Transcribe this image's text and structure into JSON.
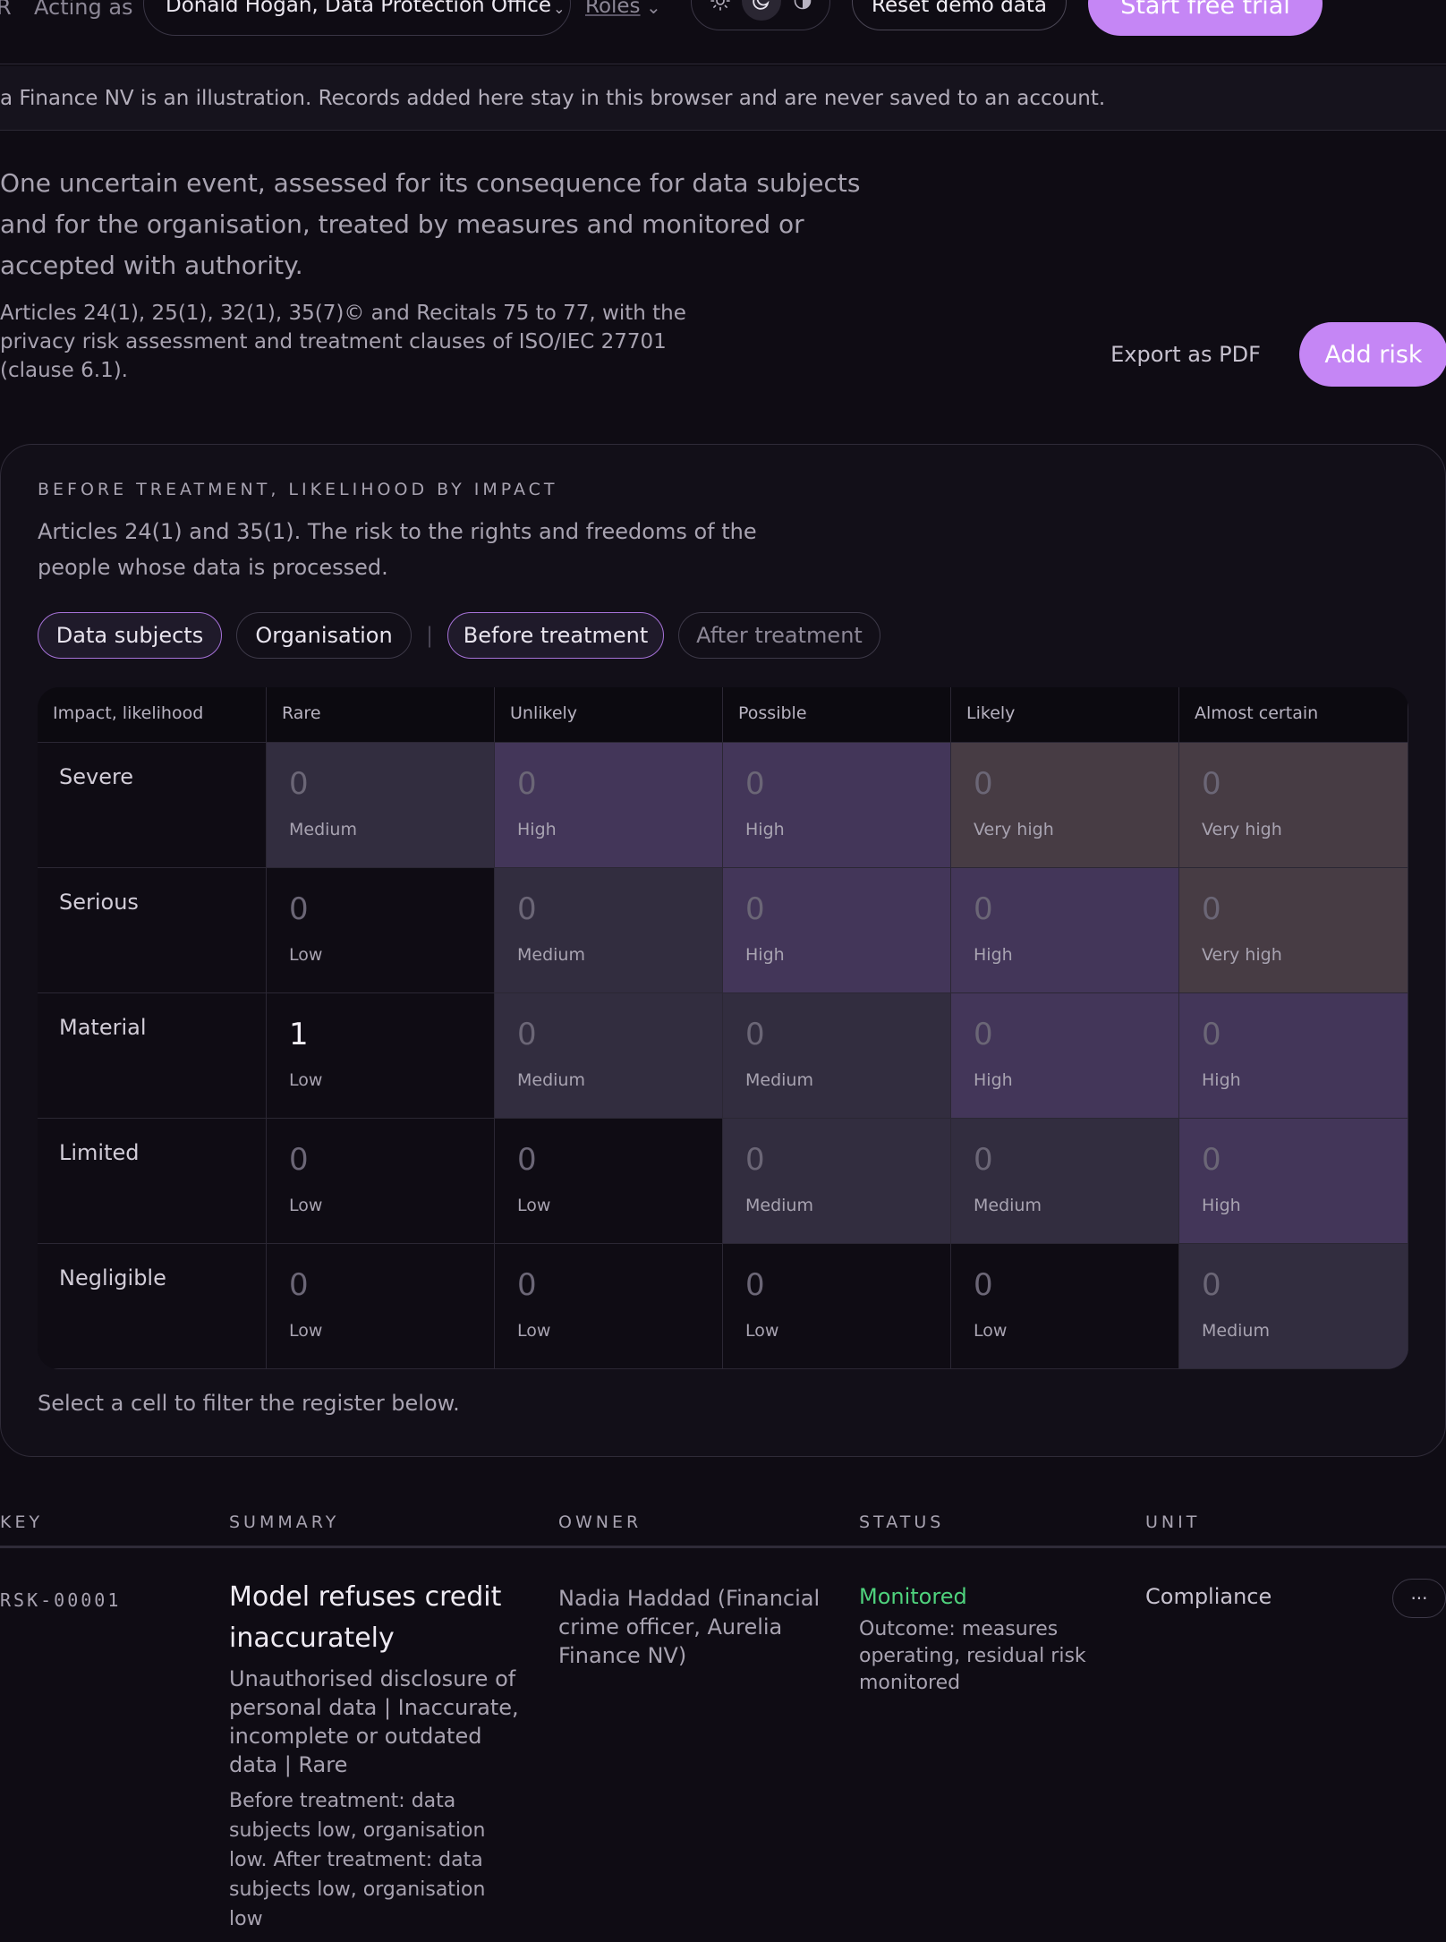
{
  "topbar": {
    "prefix": "R",
    "acting_label": "Acting as",
    "acting_user": "Donald Hogan, Data Protection Office",
    "roles_label": "Roles",
    "reset_label": "Reset demo data",
    "trial_label": "Start free trial",
    "theme_options": [
      "light",
      "dark",
      "contrast"
    ],
    "theme_selected": "dark"
  },
  "banner": {
    "text": "a Finance NV is an illustration. Records added here stay in this browser and are never saved to an account."
  },
  "intro": {
    "description": "One uncertain event, assessed for its consequence for data subjects and for the organisation, treated by measures and monitored or accepted with authority.",
    "articles": "Articles 24(1), 25(1), 32(1), 35(7)© and Recitals 75 to 77, with the privacy risk assessment and treatment clauses of ISO/IEC 27701 (clause 6.1).",
    "export_label": "Export as PDF",
    "add_label": "Add risk"
  },
  "matrix": {
    "eyebrow": "BEFORE TREATMENT, LIKELIHOOD BY IMPACT",
    "description": "Articles 24(1) and 35(1). The risk to the rights and freedoms of the people whose data is processed.",
    "chips": [
      {
        "label": "Data subjects",
        "active": true
      },
      {
        "label": "Organisation",
        "active": false
      },
      {
        "label": "Before treatment",
        "active": true
      },
      {
        "label": "After treatment",
        "active": false
      }
    ],
    "separator": "|",
    "corner_label": "Impact, likelihood",
    "likelihoods": [
      "Rare",
      "Unlikely",
      "Possible",
      "Likely",
      "Almost certain"
    ],
    "rows": [
      {
        "impact": "Severe",
        "cells": [
          {
            "count": "0",
            "level": "Medium"
          },
          {
            "count": "0",
            "level": "High"
          },
          {
            "count": "0",
            "level": "High"
          },
          {
            "count": "0",
            "level": "Very high"
          },
          {
            "count": "0",
            "level": "Very high"
          }
        ]
      },
      {
        "impact": "Serious",
        "cells": [
          {
            "count": "0",
            "level": "Low"
          },
          {
            "count": "0",
            "level": "Medium"
          },
          {
            "count": "0",
            "level": "High"
          },
          {
            "count": "0",
            "level": "High"
          },
          {
            "count": "0",
            "level": "Very high"
          }
        ]
      },
      {
        "impact": "Material",
        "cells": [
          {
            "count": "1",
            "level": "Low"
          },
          {
            "count": "0",
            "level": "Medium"
          },
          {
            "count": "0",
            "level": "Medium"
          },
          {
            "count": "0",
            "level": "High"
          },
          {
            "count": "0",
            "level": "High"
          }
        ]
      },
      {
        "impact": "Limited",
        "cells": [
          {
            "count": "0",
            "level": "Low"
          },
          {
            "count": "0",
            "level": "Low"
          },
          {
            "count": "0",
            "level": "Medium"
          },
          {
            "count": "0",
            "level": "Medium"
          },
          {
            "count": "0",
            "level": "High"
          }
        ]
      },
      {
        "impact": "Negligible",
        "cells": [
          {
            "count": "0",
            "level": "Low"
          },
          {
            "count": "0",
            "level": "Low"
          },
          {
            "count": "0",
            "level": "Low"
          },
          {
            "count": "0",
            "level": "Low"
          },
          {
            "count": "0",
            "level": "Medium"
          }
        ]
      }
    ],
    "hint": "Select a cell to filter the register below.",
    "colors": {
      "Low": "#0f0c14",
      "Medium": "#322d3f",
      "High": "#433659",
      "Very high": "#473c44"
    }
  },
  "register": {
    "columns": [
      "KEY",
      "SUMMARY",
      "OWNER",
      "STATUS",
      "UNIT"
    ],
    "rows": [
      {
        "key": "RSK-00001",
        "title": "Model refuses credit inaccurately",
        "categories": "Unauthorised disclosure of personal data | Inaccurate, incomplete or outdated data | Rare",
        "note": "Before treatment: data subjects low, organisation low. After treatment: data subjects low, organisation low",
        "owner": "Nadia Haddad (Financial crime officer, Aurelia Finance NV)",
        "status": "Monitored",
        "outcome": "Outcome: measures operating, residual risk monitored",
        "unit": "Compliance",
        "more": "···"
      }
    ],
    "status_color": "#4fd27d"
  },
  "accent": "#c586f5"
}
